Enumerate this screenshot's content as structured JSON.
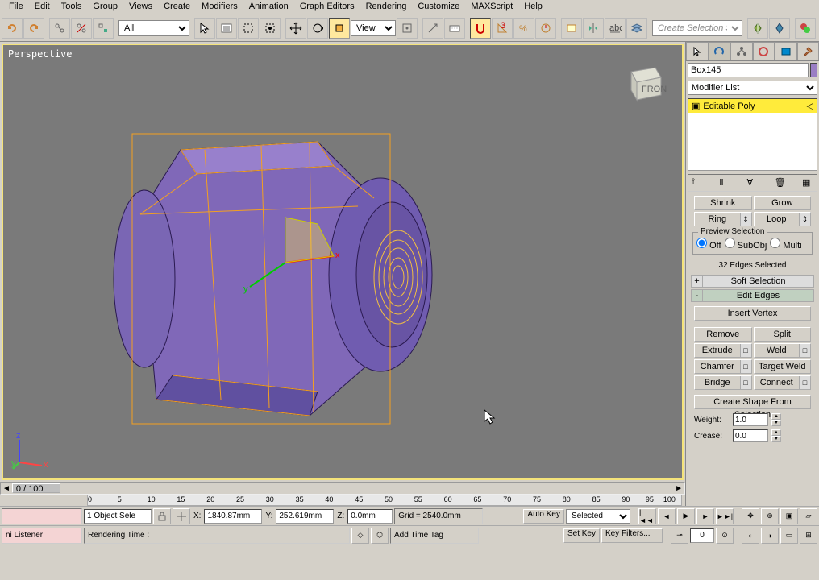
{
  "menu": [
    "File",
    "Edit",
    "Tools",
    "Group",
    "Views",
    "Create",
    "Modifiers",
    "Animation",
    "Graph Editors",
    "Rendering",
    "Customize",
    "MAXScript",
    "Help"
  ],
  "toolbar": {
    "layer_sel": "All",
    "ref_sel": "View",
    "sel_set": "Create Selection Set"
  },
  "viewport": {
    "label": "Perspective",
    "cube_face": "FRONT",
    "frame": "0 / 100"
  },
  "cmd": {
    "object_name": "Box145",
    "modifier_list": "Modifier List",
    "stack_item": "Editable Poly",
    "sel_buttons": {
      "shrink": "Shrink",
      "grow": "Grow",
      "ring": "Ring",
      "loop": "Loop"
    },
    "preview_title": "Preview Selection",
    "preview_opts": [
      "Off",
      "SubObj",
      "Multi"
    ],
    "sel_info": "32 Edges Selected",
    "rollouts": {
      "soft": "Soft Selection",
      "edit": "Edit Edges"
    },
    "edit_btns": {
      "insert": "Insert Vertex",
      "remove": "Remove",
      "split": "Split",
      "extrude": "Extrude",
      "weld": "Weld",
      "chamfer": "Chamfer",
      "target": "Target Weld",
      "bridge": "Bridge",
      "connect": "Connect",
      "shape": "Create Shape From Selection"
    },
    "weight_lbl": "Weight:",
    "weight_val": "1.0",
    "crease_lbl": "Crease:",
    "crease_val": "0.0"
  },
  "ruler": [
    "0",
    "5",
    "10",
    "15",
    "20",
    "25",
    "30",
    "35",
    "40",
    "45",
    "50",
    "55",
    "60",
    "65",
    "70",
    "75",
    "80",
    "85",
    "90",
    "95",
    "100"
  ],
  "status": {
    "obj_sel": "1 Object Sele",
    "x_lbl": "X:",
    "x": "1840.87mm",
    "y_lbl": "Y:",
    "y": "252.619mm",
    "z_lbl": "Z:",
    "z": "0.0mm",
    "grid": "Grid = 2540.0mm",
    "autokey": "Auto Key",
    "setkey": "Set Key",
    "sel_mode": "Selected",
    "keyfilt": "Key Filters...",
    "listener": "ni Listener",
    "render": "Rendering Time :",
    "addtag": "Add Time Tag"
  }
}
